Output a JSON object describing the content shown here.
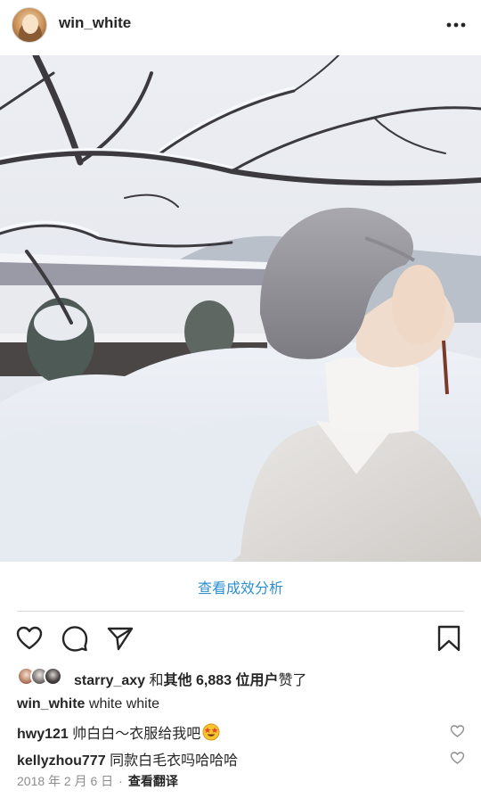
{
  "post": {
    "username": "win_white",
    "insights_label": "查看成效分析"
  },
  "likes": {
    "first_liker": "starry_axy",
    "connector": " 和",
    "others": "其他 6,883 位用户",
    "suffix": "赞了"
  },
  "caption": {
    "author": "win_white",
    "text": "white white"
  },
  "comments": [
    {
      "author": "hwy121",
      "text": "帅白白～衣服给我吧",
      "emoji": "star-struck-emoji"
    },
    {
      "author": "kellyzhou777",
      "text": "同款白毛衣吗哈哈哈"
    }
  ],
  "meta": {
    "date": "2018 年 2 月 6 日",
    "separator": "·",
    "translate": "查看翻译"
  },
  "icons": {
    "more": "more-horizontal-icon",
    "like": "heart-icon",
    "comment": "comment-bubble-icon",
    "share": "paper-plane-icon",
    "save": "bookmark-icon"
  },
  "colors": {
    "link_blue": "#2d8fcf",
    "text": "#262626",
    "secondary": "#8e8e8e"
  }
}
